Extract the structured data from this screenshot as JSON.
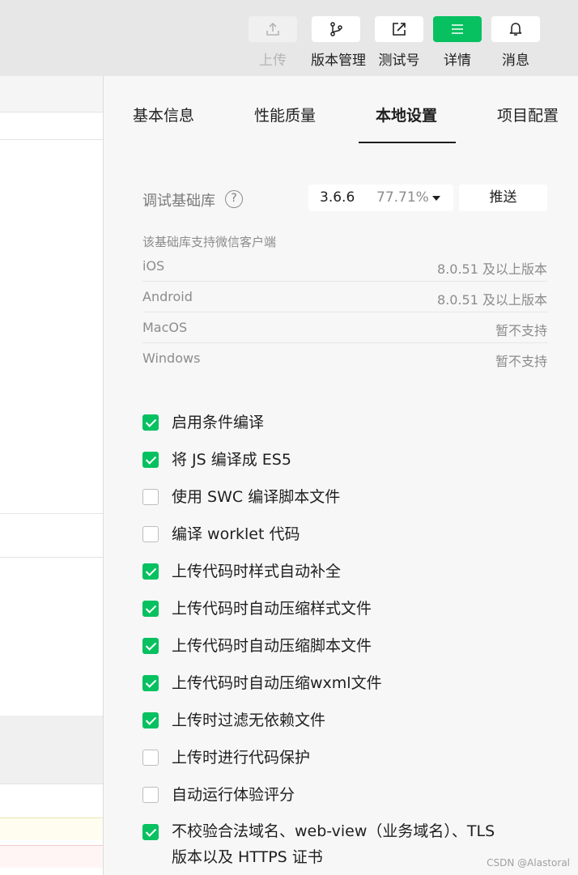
{
  "toolbar": {
    "upload": {
      "label": "上传",
      "icon": "upload-icon"
    },
    "version_mgmt": {
      "label": "版本管理",
      "icon": "branch-icon"
    },
    "test_account": {
      "label": "测试号",
      "icon": "external-link-icon"
    },
    "details": {
      "label": "详情",
      "icon": "menu-icon"
    },
    "messages": {
      "label": "消息",
      "icon": "bell-icon"
    },
    "accent_color": "#07c160"
  },
  "tabs": [
    {
      "label": "基本信息"
    },
    {
      "label": "性能质量"
    },
    {
      "label": "本地设置",
      "active": true
    },
    {
      "label": "项目配置"
    }
  ],
  "debug_lib": {
    "label": "调试基础库",
    "help_glyph": "?",
    "version": "3.6.6",
    "percent": "77.71%",
    "push_label": "推送"
  },
  "support": {
    "note": "该基础库支持微信客户端",
    "platforms": [
      {
        "name": "iOS",
        "version": "8.0.51 及以上版本"
      },
      {
        "name": "Android",
        "version": "8.0.51 及以上版本"
      },
      {
        "name": "MacOS",
        "version": "暂不支持"
      },
      {
        "name": "Windows",
        "version": "暂不支持"
      }
    ]
  },
  "options": [
    {
      "label": "启用条件编译",
      "checked": true
    },
    {
      "label": "将 JS 编译成 ES5",
      "checked": true
    },
    {
      "label": "使用 SWC 编译脚本文件",
      "checked": false
    },
    {
      "label": "编译 worklet 代码",
      "checked": false
    },
    {
      "label": "上传代码时样式自动补全",
      "checked": true
    },
    {
      "label": "上传代码时自动压缩样式文件",
      "checked": true
    },
    {
      "label": "上传代码时自动压缩脚本文件",
      "checked": true
    },
    {
      "label": "上传代码时自动压缩wxml文件",
      "checked": true
    },
    {
      "label": "上传时过滤无依赖文件",
      "checked": true
    },
    {
      "label": "上传时进行代码保护",
      "checked": false
    },
    {
      "label": "自动运行体验评分",
      "checked": false
    },
    {
      "label": "不校验合法域名、web-view（业务域名）、TLS 版本以及 HTTPS 证书",
      "checked": true
    }
  ],
  "watermark": "CSDN @Alastoral"
}
